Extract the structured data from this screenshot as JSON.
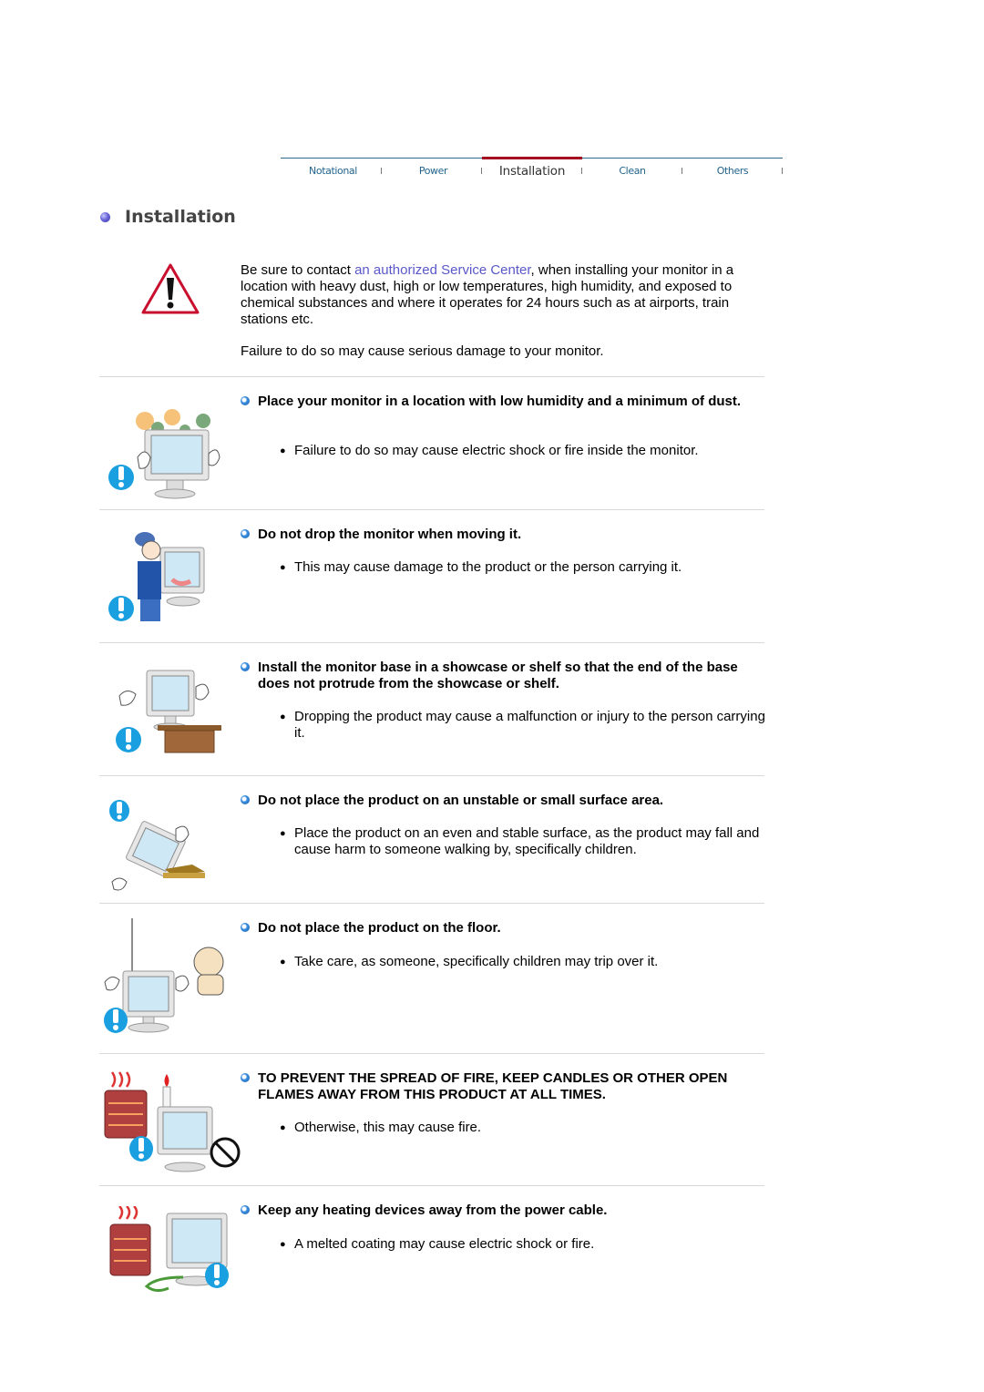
{
  "tabs": [
    {
      "label": "Notational",
      "active": false
    },
    {
      "label": "Power",
      "active": false
    },
    {
      "label": "Installation",
      "active": true
    },
    {
      "label": "Clean",
      "active": false
    },
    {
      "label": "Others",
      "active": false
    }
  ],
  "page_title": "Installation",
  "intro": {
    "text_before_link": "Be sure to contact ",
    "link_text": "an authorized Service Center",
    "text_after_link": ", when installing your monitor in a location with heavy dust, high or low temperatures, high humidity, and exposed to chemical substances and where it operates for 24 hours such as at airports, train stations etc.",
    "failure_text": "Failure to do so may cause serious damage to your monitor."
  },
  "sections": [
    {
      "heading": "Place your monitor in a location with low humidity and a minimum of dust.",
      "bullet": "Failure to do so may cause electric shock or fire inside the monitor.",
      "image": "monitor-dust-illustration"
    },
    {
      "heading": "Do not drop the monitor when moving it.",
      "bullet": "This may cause damage to the product or the person carrying it.",
      "image": "person-carrying-monitor-illustration"
    },
    {
      "heading": "Install the monitor base in a showcase or shelf so that the end of the base does not protrude from the showcase or shelf.",
      "bullet": "Dropping the product may cause a malfunction or injury to the person carrying it.",
      "image": "monitor-on-shelf-illustration"
    },
    {
      "heading": "Do not place the product on an unstable or small surface area.",
      "bullet": "Place the product on an even and stable surface, as the product may fall and cause harm to someone walking by, specifically children.",
      "image": "monitor-falling-illustration"
    },
    {
      "heading": "Do not place the product on the floor.",
      "bullet": "Take care, as someone, specifically children may trip over it.",
      "image": "monitor-on-floor-illustration"
    },
    {
      "heading": "TO PREVENT THE SPREAD OF FIRE, KEEP CANDLES OR OTHER OPEN FLAMES AWAY FROM THIS PRODUCT AT ALL TIMES.",
      "bullet": "Otherwise, this may cause fire.",
      "image": "candle-fire-illustration"
    },
    {
      "heading": "Keep any heating devices away from the power cable.",
      "bullet": "A melted coating may cause electric shock or fire.",
      "image": "heater-cable-illustration"
    }
  ],
  "colors": {
    "tab_text": "#23648c",
    "active_tab_accent": "#a30d1e",
    "link": "#5a58c8",
    "warning_red": "#c8102e",
    "caution_blue": "#1aa0e0"
  }
}
